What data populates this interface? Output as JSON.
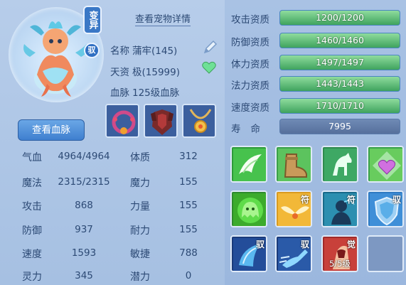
{
  "pet": {
    "mutant_badge": "变异",
    "tamed_badge": "驭",
    "view_details_label": "查看宠物详情",
    "name_label": "名称",
    "name_value": "蒲牢(145)",
    "aptitude_label": "天资",
    "aptitude_value": "极(15999)",
    "bloodline_label": "血脉",
    "bloodline_value": "125级血脉",
    "view_bloodline_label": "查看血脉"
  },
  "stats": [
    {
      "label": "气血",
      "value": "4964/4964"
    },
    {
      "label": "魔法",
      "value": "2315/2315"
    },
    {
      "label": "攻击",
      "value": "868"
    },
    {
      "label": "防御",
      "value": "937"
    },
    {
      "label": "速度",
      "value": "1593"
    },
    {
      "label": "灵力",
      "value": "345"
    }
  ],
  "attributes": [
    {
      "label": "体质",
      "value": "312"
    },
    {
      "label": "魔力",
      "value": "155"
    },
    {
      "label": "力量",
      "value": "155"
    },
    {
      "label": "耐力",
      "value": "155"
    },
    {
      "label": "敏捷",
      "value": "788"
    },
    {
      "label": "潜力",
      "value": "0"
    }
  ],
  "aptitudes": [
    {
      "label": "攻击资质",
      "text": "1200/1200",
      "fill": 1.0
    },
    {
      "label": "防御资质",
      "text": "1460/1460",
      "fill": 1.0
    },
    {
      "label": "体力资质",
      "text": "1497/1497",
      "fill": 1.0
    },
    {
      "label": "法力资质",
      "text": "1443/1443",
      "fill": 1.0
    },
    {
      "label": "速度资质",
      "text": "1710/1710",
      "fill": 1.0
    }
  ],
  "life": {
    "label": "寿命",
    "value": "7995"
  },
  "skill_tags": {
    "talisman": "符",
    "tame": "驭",
    "awaken": "觉",
    "awaken_level": "5/5级"
  },
  "icons": {
    "edit": "pencil-icon",
    "favorite": "heart-icon"
  },
  "colors": {
    "aptitude_fill": "#3fa35e",
    "life_bar": "#6f8ab5",
    "button": "#3f7fcf"
  }
}
